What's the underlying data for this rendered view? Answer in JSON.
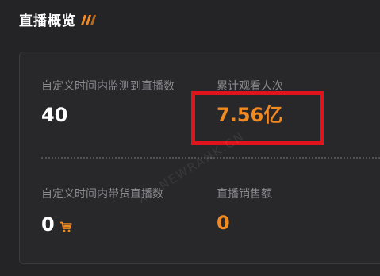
{
  "header": {
    "title": "直播概览"
  },
  "stats": {
    "monitored_live": {
      "label": "自定义时间内监测到直播数",
      "value": "40"
    },
    "total_viewers": {
      "label": "累计观看人次",
      "value": "7.56亿"
    },
    "selling_live": {
      "label": "自定义时间内带货直播数",
      "value": "0"
    },
    "live_sales": {
      "label": "直播销售额",
      "value": "0"
    }
  },
  "watermark": "XD.NEWRANK.CN",
  "colors": {
    "accent": "#f28a22",
    "highlight": "#e0141c",
    "background": "#242427"
  }
}
